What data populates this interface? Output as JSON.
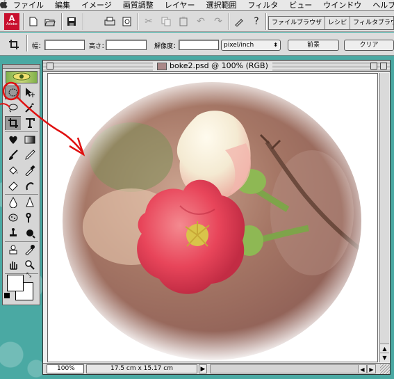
{
  "menubar": {
    "apple_icon": "",
    "items": [
      "ファイル",
      "編集",
      "イメージ",
      "画質調整",
      "レイヤー",
      "選択範囲",
      "フィルタ",
      "ビュー",
      "ウインドウ",
      "ヘルプ"
    ]
  },
  "toolbar": {
    "icons": [
      "adobe-logo",
      "new-document-icon",
      "open-folder-icon",
      "save-icon",
      "print-icon",
      "print-preview-icon",
      "cut-icon",
      "copy-icon",
      "paste-icon",
      "undo-icon",
      "redo-icon",
      "help-icon"
    ],
    "palette_tabs": [
      "ファイルブラウザ",
      "レシピ",
      "フィルタブラウザ"
    ],
    "adobe_label": "A",
    "adobe_sub": "Adobe"
  },
  "options_bar": {
    "width_label": "幅：",
    "height_label": "高さ：",
    "resolution_label": "解像度：",
    "unit_value": "pixel/inch",
    "front_image_button": "前景",
    "clear_button": "クリア"
  },
  "document": {
    "title": "boke2.psd @ 100% (RGB)",
    "zoom": "100%",
    "size_info": "17.5 cm x 15.17 cm"
  },
  "colors": {
    "desktop": "#4aa9a3",
    "annotation": "#e01010",
    "flower_pink": "#e8455a",
    "bud_white": "#f4ead2"
  }
}
